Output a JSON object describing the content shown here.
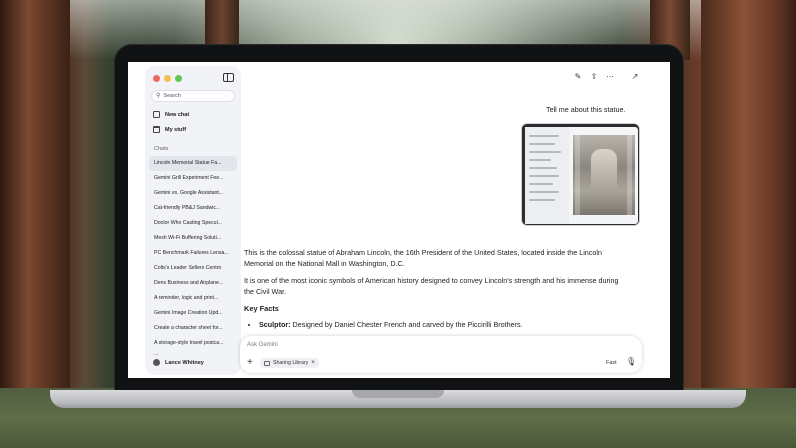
{
  "sidebar": {
    "search_placeholder": "Search",
    "new_chat_label": "New chat",
    "my_stuff_label": "My stuff",
    "chats_heading": "Chats",
    "chats": [
      "Lincoln Memorial Statue Fa...",
      "Gemini Grill Experiment Fee...",
      "Gemini vs. Google Assistant...",
      "Cat-friendly PB&J Sandwic...",
      "Doctor Who Casting Specul...",
      "Mesh Wi-Fi Buffering Soluti...",
      "PC Benchmark Failures Lensa...",
      "Colts's Leader Sellers Centro",
      "Dens Business and Airplane...",
      "A reminder, logic and print...",
      "Gemini Image Creation Upd...",
      "Create a character sheet for...",
      "A storage-style travel postca...",
      "..."
    ],
    "active_chat_index": 0,
    "user_name": "Lance Whitney"
  },
  "toolbar": {
    "edit_icon": "edit-icon",
    "share_icon": "share-icon",
    "more_icon": "more-icon",
    "expand_icon": "expand-icon"
  },
  "conversation": {
    "user_message": "Tell me about this statue.",
    "response": {
      "p1": "This is the colossal statue of Abraham Lincoln, the 16th President of the United States, located inside the Lincoln Memorial on the National Mall in Washington, D.C.",
      "p2": "It is one of the most iconic symbols of American history designed to convey Lincoln's strength and his immense during the Civil War.",
      "heading": "Key Facts",
      "bullet1_label": "Sculptor:",
      "bullet1_text": " Designed by Daniel Chester French and carved by the Piccirilli Brothers."
    }
  },
  "composer": {
    "placeholder": "Ask Gemini",
    "chip_label": "Sharing Library",
    "mode_label": "Fast"
  }
}
